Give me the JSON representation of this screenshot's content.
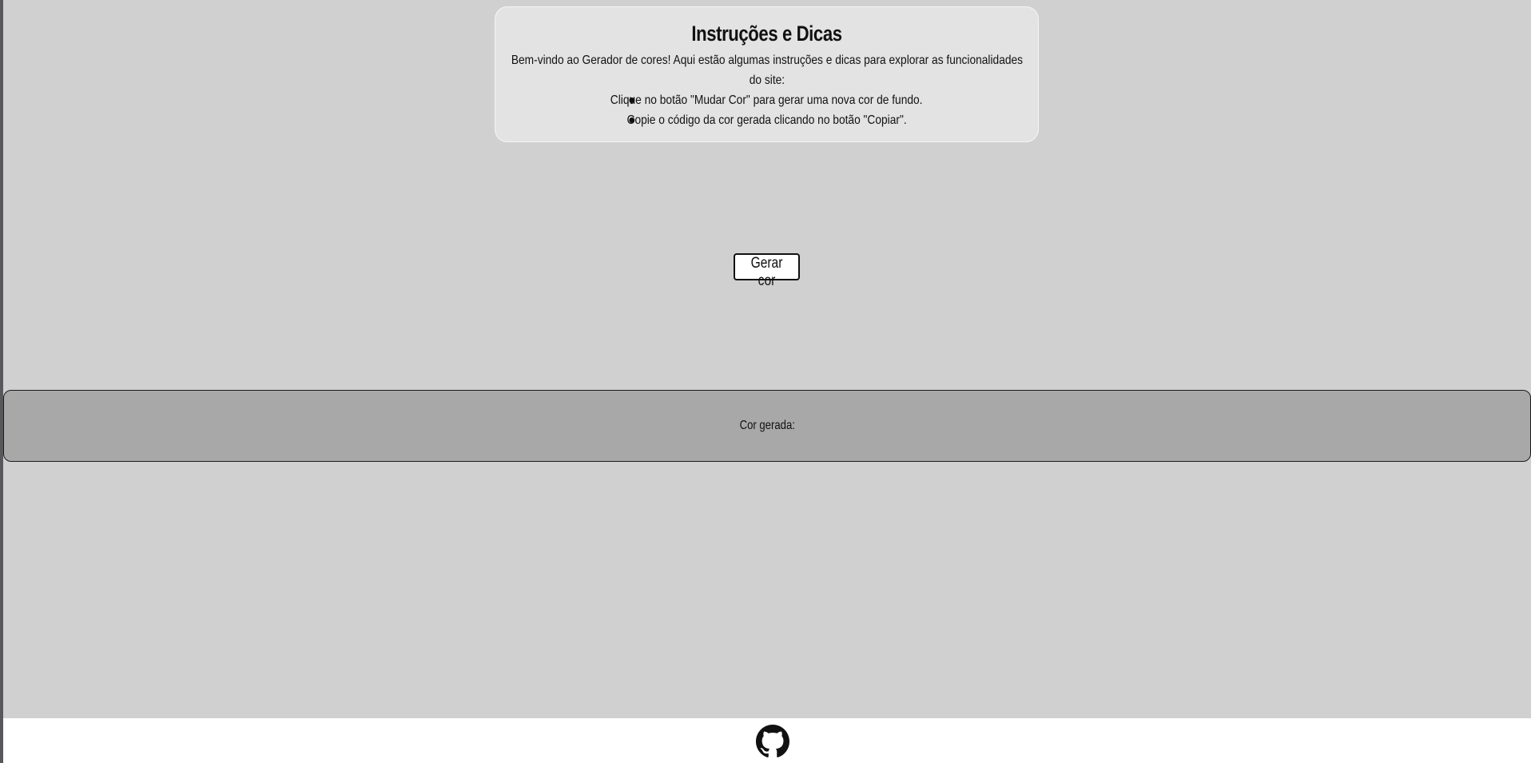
{
  "instructions": {
    "title": "Instruções e Dicas",
    "intro": "Bem-vindo ao Gerador de cores! Aqui estão algumas instruções e dicas para explorar as funcionalidades do site:",
    "tips": [
      "Clique no botão \"Mudar Cor\" para gerar uma nova cor de fundo.",
      "Copie o código da cor gerada clicando no botão \"Copiar\"."
    ]
  },
  "generator": {
    "button_label": "Gerar cor"
  },
  "result": {
    "label": "Cor gerada:"
  },
  "footer": {
    "icon": "github-icon"
  },
  "colors": {
    "page_background": "#d0d0d0",
    "card_background": "#e3e3e3",
    "result_background": "#a8a8a8",
    "footer_background": "#ffffff"
  }
}
